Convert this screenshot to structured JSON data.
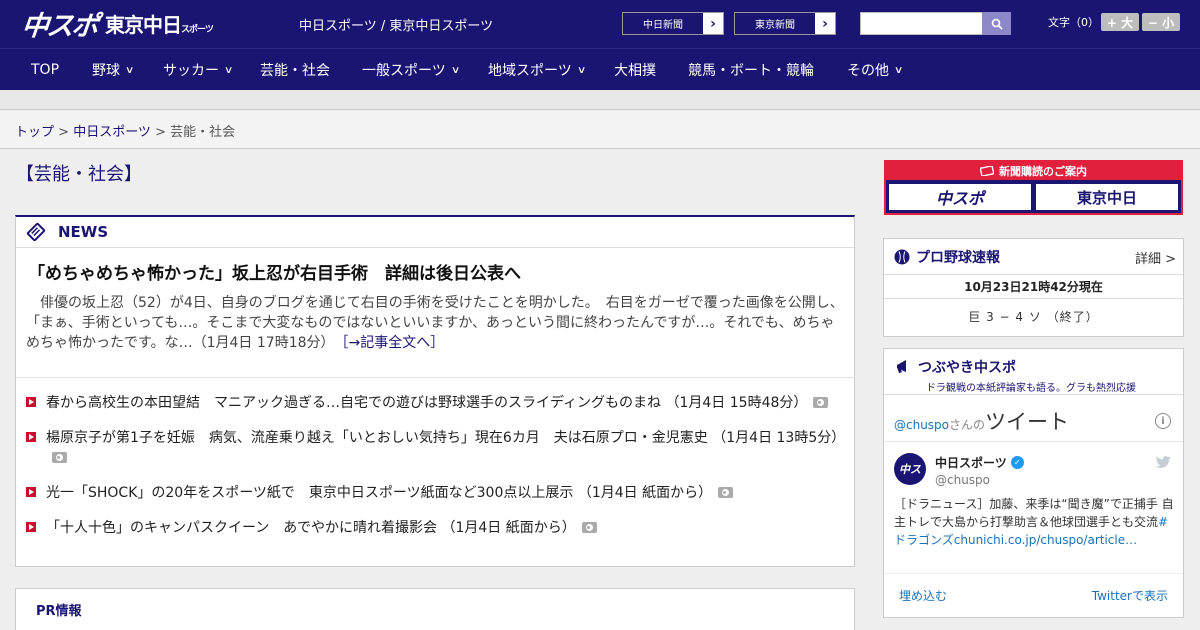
{
  "header": {
    "logo_main": "中スポ",
    "logo_sub": "東京中日",
    "logo_sub_small": "スポーツ",
    "tagline": "中日スポーツ / 東京中日スポーツ",
    "paper_buttons": [
      {
        "label": "中日新聞"
      },
      {
        "label": "東京新聞"
      }
    ],
    "search_placeholder": "",
    "font_size_label": "文字（0）",
    "font_bigger": "+ 大",
    "font_smaller": "− 小"
  },
  "nav": {
    "items": [
      {
        "label": "TOP",
        "dropdown": false
      },
      {
        "label": "野球",
        "dropdown": true
      },
      {
        "label": "サッカー",
        "dropdown": true
      },
      {
        "label": "芸能・社会",
        "dropdown": false
      },
      {
        "label": "一般スポーツ",
        "dropdown": true
      },
      {
        "label": "地域スポーツ",
        "dropdown": true
      },
      {
        "label": "大相撲",
        "dropdown": false
      },
      {
        "label": "競馬・ボート・競輪",
        "dropdown": false
      },
      {
        "label": "その他",
        "dropdown": true
      }
    ],
    "chevron": "∨"
  },
  "breadcrumb": {
    "home": "トップ",
    "sep": " > ",
    "section": "中日スポーツ",
    "current": "芸能・社会"
  },
  "page_title": "【芸能・社会】",
  "news": {
    "heading": "NEWS",
    "lead": {
      "title": "「めちゃめちゃ怖かった」坂上忍が右目手術　詳細は後日公表へ",
      "body": "俳優の坂上忍（52）が4日、自身のブログを通じて右目の手術を受けたことを明かした。　右目をガーゼで覆った画像を公開し、「まぁ、手術といっても…。そこまで大変なものではないといいますか、あっという間に終わったんですが…。それでも、めちゃめちゃ怖かったです。な…",
      "meta": "（1月4日 17時18分）",
      "more": "［→記事全文へ］"
    },
    "items": [
      {
        "text": "春から高校生の本田望結　マニアック過ぎる…自宅での遊びは野球選手のスライディングものまね",
        "meta": "（1月4日 15時48分）",
        "photo": true
      },
      {
        "text": "楊原京子が第1子を妊娠　病気、流産乗り越え「いとおしい気持ち」現在6カ月　夫は石原プロ・金児憲史",
        "meta": "（1月4日 13時5分）",
        "photo": true
      },
      {
        "text": "光一「SHOCK」の20年をスポーツ紙で　東京中日スポーツ紙面など300点以上展示",
        "meta": "（1月4日 紙面から）",
        "photo": true
      },
      {
        "text": "「十人十色」のキャンパスクイーン　あでやかに晴れ着撮影会",
        "meta": "（1月4日 紙面から）",
        "photo": true
      }
    ]
  },
  "pr": {
    "label": "PR情報"
  },
  "sidebar": {
    "subscribe": {
      "title": "新聞購読のご案内",
      "btn1": "中スポ",
      "btn2": "東京中日"
    },
    "baseball": {
      "title": "プロ野球速報",
      "detail": "詳細 >",
      "time": "10月23日21時42分現在",
      "score": "巨 3 − 4 ソ （終了）"
    },
    "tweets": {
      "title": "つぶやき中スポ",
      "subtitle": "ドラ観戦の本紙評論家も語る。グラも熱烈応援",
      "account_link": "@chuspo",
      "account_suffix": "さんの",
      "heading_big": "ツイート",
      "name": "中日スポーツ",
      "handle": "@chuspo",
      "text": "［ドラニュース］加藤、来季は“聞き魔”で正捕手 自主トレで大島から打撃助言＆他球団選手とも交流",
      "link": "#ドラゴンズchunichi.co.jp/chuspo/article…",
      "embed": "埋め込む",
      "view_on_twitter": "Twitterで表示"
    }
  },
  "colors": {
    "brand_navy": "#1a1573",
    "accent_red": "#c8102e"
  }
}
